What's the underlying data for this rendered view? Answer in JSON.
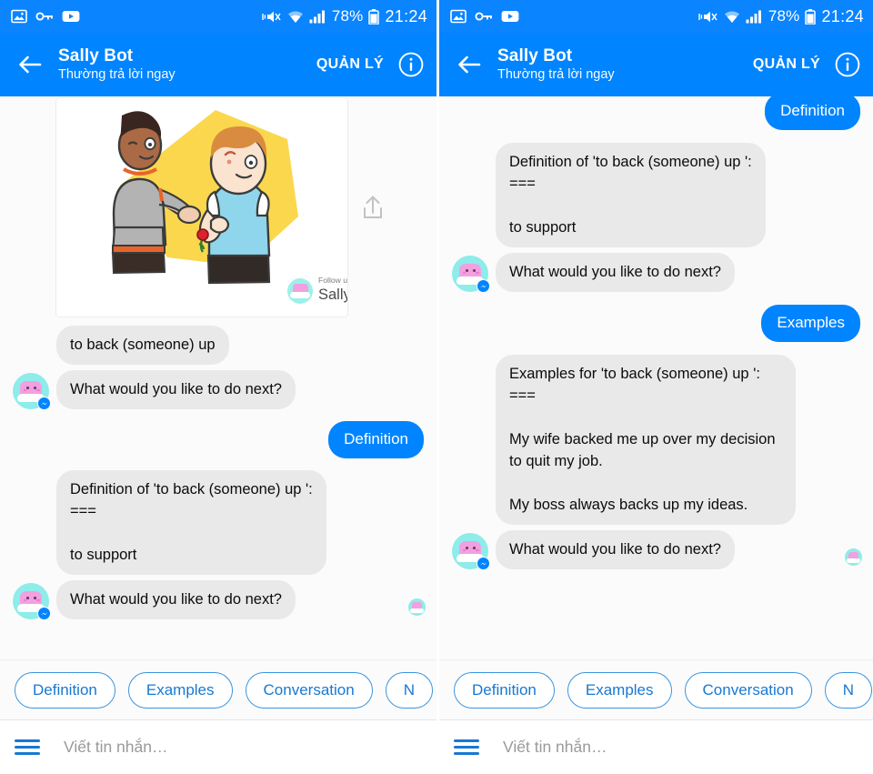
{
  "status_bar": {
    "left_icons": [
      "image-icon",
      "key-icon",
      "youtube-icon"
    ],
    "right_icons": [
      "vibrate-mute-icon",
      "wifi-icon",
      "signal-icon",
      "battery-icon"
    ],
    "battery_percent": "78%",
    "clock": "21:24"
  },
  "app_bar": {
    "back_icon": "back-arrow-icon",
    "title": "Sally Bot",
    "subtitle": "Thường trả lời ngay",
    "manage_label": "QUẢN LÝ",
    "info_icon": "info-icon"
  },
  "colors": {
    "header_blue": "#0084FF",
    "status_blue": "#0A84FF",
    "outgoing_bubble": "#0084FF",
    "incoming_bubble": "#E9E9E9",
    "chip_border": "#3B95E0",
    "chip_text": "#1878D2",
    "chat_background": "#FBFBFB",
    "avatar_cyan": "#8EECEA",
    "avatar_pink": "#F2A0E0",
    "illustration_yellow": "#FBD74D"
  },
  "card": {
    "name": "illustration-card",
    "branding_top": "Follow us on Facebook!",
    "branding_name": "Sally Bot",
    "share_icon": "share-icon"
  },
  "left_panel": {
    "messages": [
      {
        "from": "bot",
        "type": "card",
        "text": ""
      },
      {
        "from": "bot",
        "type": "text",
        "text": "to back (someone) up"
      },
      {
        "from": "bot",
        "type": "text",
        "text": "What would you like to do next?",
        "avatar": true
      },
      {
        "from": "user",
        "type": "text",
        "text": "Definition"
      },
      {
        "from": "bot",
        "type": "text",
        "text": "Definition of 'to back (someone) up ':\n===\n\nto support"
      },
      {
        "from": "bot",
        "type": "text",
        "text": "What would you like to do next?",
        "avatar": true,
        "seen": true
      }
    ]
  },
  "right_panel": {
    "messages": [
      {
        "from": "user",
        "type": "text",
        "text": "Definition"
      },
      {
        "from": "bot",
        "type": "text",
        "text": "Definition of 'to back (someone) up ':\n===\n\nto support"
      },
      {
        "from": "bot",
        "type": "text",
        "text": "What would you like to do next?",
        "avatar": true
      },
      {
        "from": "user",
        "type": "text",
        "text": "Examples"
      },
      {
        "from": "bot",
        "type": "text",
        "text": "Examples for 'to back (someone) up ':\n===\n\nMy wife backed me up over my decision to quit my job.\n\nMy boss always backs up my ideas."
      },
      {
        "from": "bot",
        "type": "text",
        "text": "What would you like to do next?",
        "avatar": true,
        "seen": true
      }
    ]
  },
  "quick_replies": [
    {
      "label": "Definition"
    },
    {
      "label": "Examples"
    },
    {
      "label": "Conversation"
    },
    {
      "label": "N"
    }
  ],
  "composer": {
    "menu_icon": "hamburger-menu-icon",
    "placeholder": "Viết tin nhắn…",
    "value": ""
  }
}
